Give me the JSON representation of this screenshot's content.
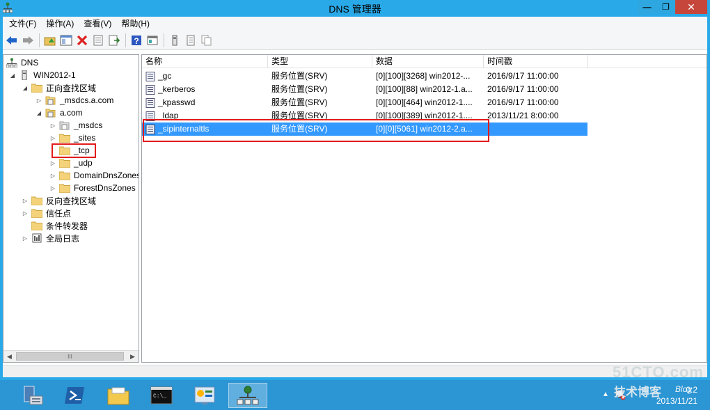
{
  "window": {
    "title": "DNS 管理器",
    "minimize_label": "—",
    "maximize_label": "❐",
    "close_label": "✕"
  },
  "menubar": {
    "items": [
      "文件(F)",
      "操作(A)",
      "查看(V)",
      "帮助(H)"
    ]
  },
  "toolbar": {
    "buttons": [
      "back-icon",
      "forward-icon",
      "up-folder-icon",
      "show-hide-tree-icon",
      "delete-icon",
      "properties-icon",
      "export-list-icon",
      "help-icon",
      "console-icon",
      "server-icon",
      "list-icon",
      "copy-icon"
    ]
  },
  "tree": {
    "items": [
      {
        "label": "DNS",
        "level": 0,
        "expander": "",
        "icon": "dns-root-icon"
      },
      {
        "label": "WIN2012-1",
        "level": 1,
        "expander": "◢",
        "icon": "server-icon"
      },
      {
        "label": "正向查找区域",
        "level": 2,
        "expander": "◢",
        "icon": "folder-icon"
      },
      {
        "label": "_msdcs.a.com",
        "level": 3,
        "expander": "▷",
        "icon": "zone-icon"
      },
      {
        "label": "a.com",
        "level": 3,
        "expander": "◢",
        "icon": "zone-icon"
      },
      {
        "label": "_msdcs",
        "level": 4,
        "expander": "▷",
        "icon": "folder-grey-icon"
      },
      {
        "label": "_sites",
        "level": 4,
        "expander": "▷",
        "icon": "folder-icon"
      },
      {
        "label": "_tcp",
        "level": 4,
        "expander": "",
        "icon": "folder-icon"
      },
      {
        "label": "_udp",
        "level": 4,
        "expander": "▷",
        "icon": "folder-icon"
      },
      {
        "label": "DomainDnsZones",
        "level": 4,
        "expander": "▷",
        "icon": "folder-icon"
      },
      {
        "label": "ForestDnsZones",
        "level": 4,
        "expander": "▷",
        "icon": "folder-icon"
      },
      {
        "label": "反向查找区域",
        "level": 2,
        "expander": "▷",
        "icon": "folder-icon"
      },
      {
        "label": "信任点",
        "level": 2,
        "expander": "▷",
        "icon": "folder-icon"
      },
      {
        "label": "条件转发器",
        "level": 2,
        "expander": "",
        "icon": "folder-icon"
      },
      {
        "label": "全局日志",
        "level": 2,
        "expander": "▷",
        "icon": "log-icon"
      }
    ],
    "scroll_left": "◀",
    "scroll_right": "▶",
    "scroll_thumb": "III"
  },
  "list": {
    "columns": [
      "名称",
      "类型",
      "数据",
      "时间戳"
    ],
    "rows": [
      {
        "name": "_gc",
        "type": "服务位置(SRV)",
        "data": "[0][100][3268] win2012-...",
        "time": "2016/9/17 11:00:00",
        "selected": false
      },
      {
        "name": "_kerberos",
        "type": "服务位置(SRV)",
        "data": "[0][100][88] win2012-1.a...",
        "time": "2016/9/17 11:00:00",
        "selected": false
      },
      {
        "name": "_kpasswd",
        "type": "服务位置(SRV)",
        "data": "[0][100][464] win2012-1....",
        "time": "2016/9/17 11:00:00",
        "selected": false
      },
      {
        "name": "_ldap",
        "type": "服务位置(SRV)",
        "data": "[0][100][389] win2012-1....",
        "time": "2013/11/21 8:00:00",
        "selected": false
      },
      {
        "name": "_sipinternaltls",
        "type": "服务位置(SRV)",
        "data": "[0][0][5061] win2012-2.a...",
        "time": "",
        "selected": true
      }
    ]
  },
  "taskbar": {
    "apps": [
      "server-manager-icon",
      "powershell-icon",
      "file-explorer-icon",
      "cmd-icon",
      "control-panel-icon",
      "dns-manager-icon"
    ],
    "clock_time": "0:2",
    "clock_date": "2013/11/21"
  },
  "watermark": {
    "site": "51CTO.com",
    "subtitle": "技术博客",
    "blog": "Blog"
  },
  "colors": {
    "titlebar": "#29a9e8",
    "close_button": "#c7463b",
    "selection": "#3399ff",
    "highlight_box": "#e21b1b",
    "taskbar": "#2c95d3"
  }
}
